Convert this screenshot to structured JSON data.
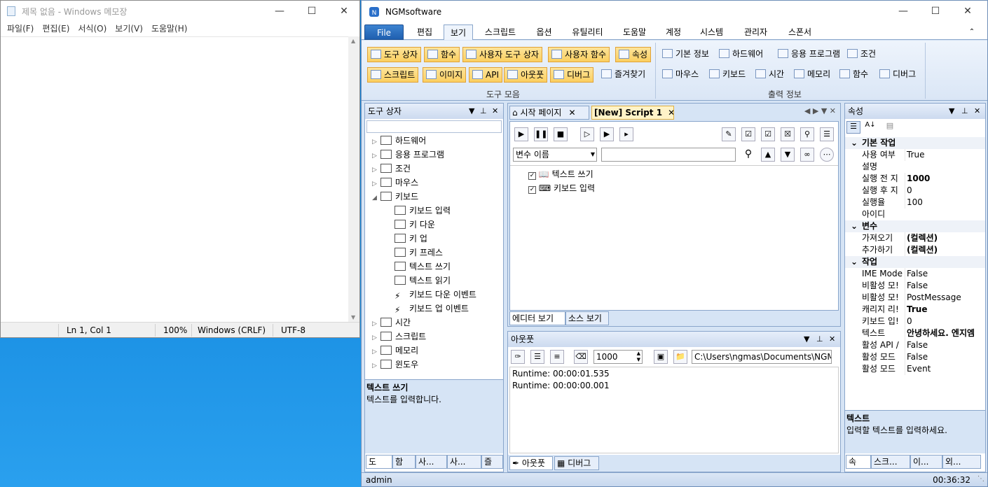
{
  "notepad": {
    "title": "제목 없음 - Windows 메모장",
    "menu": [
      "파일(F)",
      "편집(E)",
      "서식(O)",
      "보기(V)",
      "도움말(H)"
    ],
    "status": {
      "position": "Ln 1, Col 1",
      "zoom": "100%",
      "eol": "Windows (CRLF)",
      "encoding": "UTF-8"
    }
  },
  "app": {
    "title": "NGMsoftware",
    "tabs": [
      "File",
      "편집",
      "보기",
      "스크립트",
      "옵션",
      "유틸리티",
      "도움말",
      "계정",
      "시스템",
      "관리자",
      "스폰서"
    ],
    "selected_tab": "보기",
    "ribbon": {
      "group1_row1": [
        "도구 상자",
        "함수",
        "사용자 도구 상자",
        "사용자 함수",
        "속성"
      ],
      "group1_row2": [
        "스크립트",
        "이미지",
        "API",
        "아웃풋",
        "디버그",
        "즐겨찾기"
      ],
      "group1_label": "도구 모음",
      "group2_row1": [
        "기본 정보",
        "하드웨어",
        "응용 프로그램",
        "조건"
      ],
      "group2_row2": [
        "마우스",
        "키보드",
        "시간",
        "메모리",
        "함수",
        "디버그"
      ],
      "group2_label": "출력 정보"
    },
    "toolbox": {
      "title": "도구 상자",
      "items": [
        "하드웨어",
        "응용 프로그램",
        "조건",
        "마우스",
        "키보드"
      ],
      "keyboard_children": [
        "키보드 입력",
        "키 다운",
        "키 업",
        "키 프레스",
        "텍스트 쓰기",
        "텍스트 읽기",
        "키보드 다운 이벤트",
        "키보드 업 이벤트"
      ],
      "items_after": [
        "시간",
        "스크립트",
        "메모리",
        "윈도우"
      ],
      "desc_title": "텍스트 쓰기",
      "desc_text": "텍스트를 입력합니다.",
      "bottom_tabs": [
        "도",
        "함",
        "사...",
        "사...",
        "즐"
      ]
    },
    "editor": {
      "tabs": [
        "시작 페이지",
        "[New] Script 1"
      ],
      "var_select": "변수 이름",
      "lines": [
        "텍스트 쓰기",
        "키보드 입력"
      ],
      "view_tabs": [
        "에디터 보기",
        "소스 보기"
      ]
    },
    "output": {
      "title": "아웃풋",
      "count": "1000",
      "path": "C:\\Users\\ngmas\\Documents\\NGM6\\",
      "lines": [
        "Runtime: 00:00:01.535",
        "Runtime: 00:00:00.001"
      ],
      "bottom_tabs": [
        "아웃풋",
        "디버그"
      ]
    },
    "properties": {
      "title": "속성",
      "categories": [
        {
          "name": "기본 작업",
          "rows": [
            [
              "사용 여부",
              "True",
              false
            ],
            [
              "설명",
              "",
              false
            ],
            [
              "실행 전 지",
              "1000",
              true
            ],
            [
              "실행 후 지",
              "0",
              false
            ],
            [
              "실행율",
              "100",
              false
            ],
            [
              "아이디",
              "",
              false
            ]
          ]
        },
        {
          "name": "변수",
          "rows": [
            [
              "가져오기",
              "(컬렉션)",
              true
            ],
            [
              "추가하기",
              "(컬렉션)",
              true
            ]
          ]
        },
        {
          "name": "작업",
          "rows": [
            [
              "IME Mode",
              "False",
              false
            ],
            [
              "비활성 모!",
              "False",
              false
            ],
            [
              "비활성 모!",
              "PostMessage",
              false
            ],
            [
              "캐리지 리!",
              "True",
              true
            ],
            [
              "키보드 입!",
              "0",
              false
            ],
            [
              "텍스트",
              "안녕하세요. 엔지엠",
              true
            ],
            [
              "활성 API /",
              "False",
              false
            ],
            [
              "활성 모드",
              "False",
              false
            ],
            [
              "활성 모드",
              "Event",
              false
            ]
          ]
        }
      ],
      "desc_title": "텍스트",
      "desc_text": "입력할 텍스트를 입력하세요.",
      "bottom_tabs": [
        "속",
        "스크...",
        "이...",
        "외..."
      ]
    },
    "status": {
      "user": "admin",
      "time": "00:36:32"
    }
  }
}
